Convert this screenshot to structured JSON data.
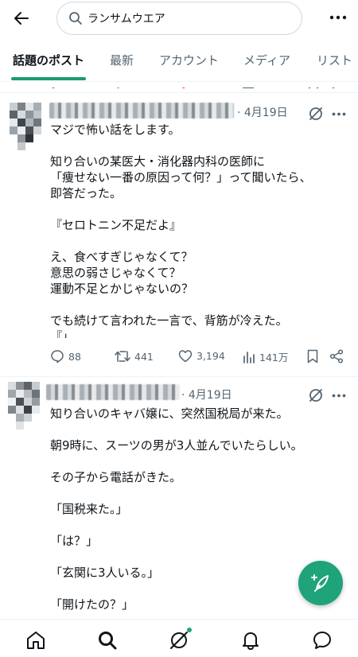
{
  "search": {
    "query": "ランサムウエア"
  },
  "tabs": [
    {
      "label": "話題のポスト",
      "active": true
    },
    {
      "label": "最新"
    },
    {
      "label": "アカウント"
    },
    {
      "label": "メディア"
    },
    {
      "label": "リスト"
    }
  ],
  "accent_color": "#1fa37a",
  "posts": [
    {
      "date": "· 4月19日",
      "lines": [
        "マジで怖い話をします。",
        "",
        "知り合いの某医大・消化器内科の医師に",
        "「痩せない一番の原因って何？」って聞いたら、",
        "即答だった。",
        "",
        "『セロトニン不足だよ』",
        "",
        "え、食べすぎじゃなくて？",
        "意思の弱さじゃなくて？",
        "運動不足とかじゃないの？",
        "",
        "でも続けて言われた一言で、背筋が冷えた。",
        "『」"
      ],
      "replies": "88",
      "reposts": "441",
      "likes": "3,194",
      "views": "141万"
    },
    {
      "date": "· 4月19日",
      "lines": [
        "知り合いのキャバ嬢に、突然国税局が来た。",
        "",
        "朝9時に、スーツの男が3人並んでいたらしい。",
        "",
        "その子から電話がきた。",
        "",
        "「国税来た。」",
        "",
        "「は？」",
        "",
        "「玄関に3人いる。」",
        "",
        "「開けたの？」"
      ]
    }
  ]
}
